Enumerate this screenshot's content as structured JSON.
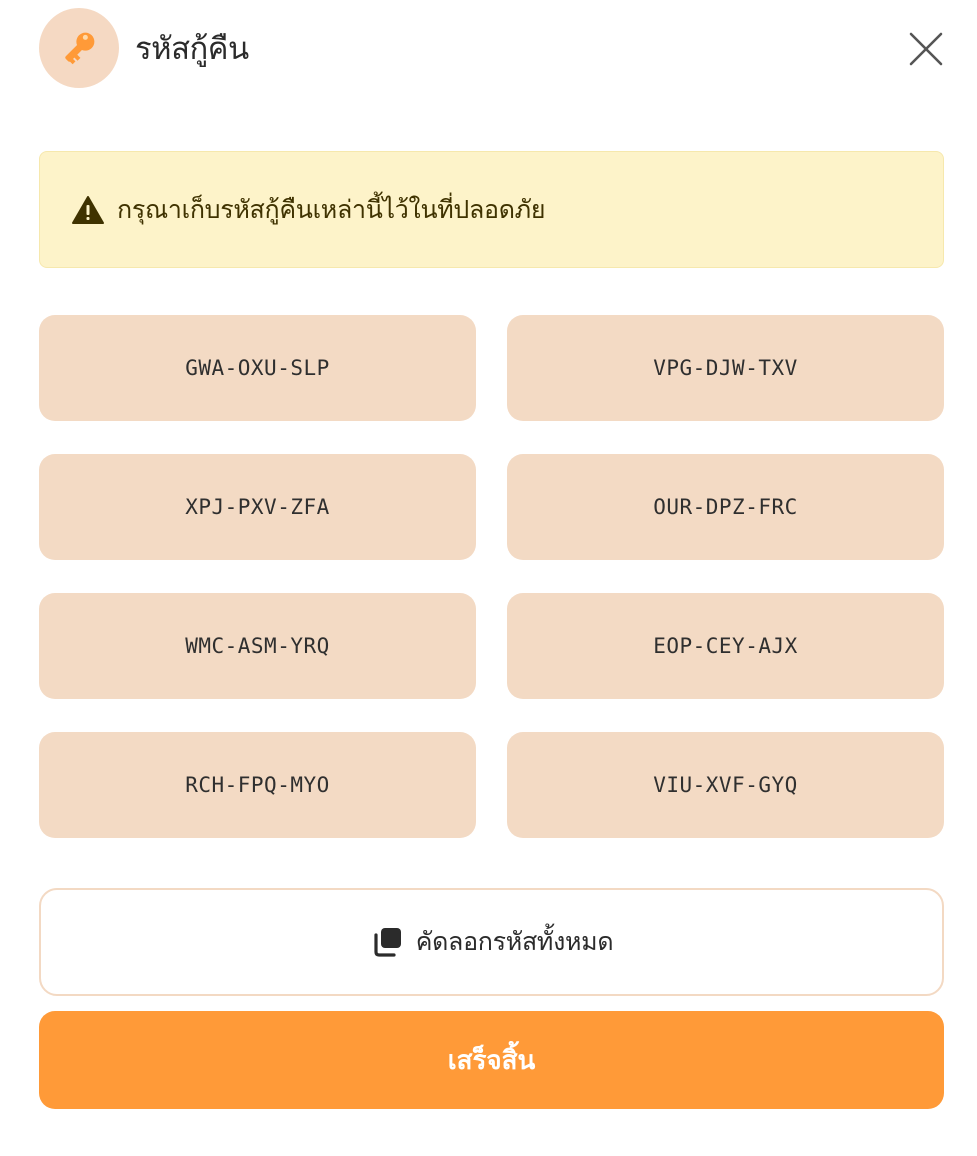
{
  "dialog": {
    "title": "รหัสกู้คืน",
    "title_icon": "key-icon",
    "close_icon": "close-icon"
  },
  "warning": {
    "icon": "warning-icon",
    "text": "กรุณาเก็บรหัสกู้คืนเหล่านี้ไว้ในที่ปลอดภัย"
  },
  "codes": [
    "GWA-OXU-SLP",
    "VPG-DJW-TXV",
    "XPJ-PXV-ZFA",
    "OUR-DPZ-FRC",
    "WMC-ASM-YRQ",
    "EOP-CEY-AJX",
    "RCH-FPQ-MYO",
    "VIU-XVF-GYQ"
  ],
  "actions": {
    "copy_icon": "copy-icon",
    "copy_label": "คัดลอกรหัสทั้งหมด",
    "done_label": "เสร็จสิ้น"
  },
  "colors": {
    "accent": "#ff9a38",
    "code_bg": "#f3dac4",
    "icon_bg": "#f5d9c3",
    "warning_bg": "#fdf3c9",
    "warning_text": "#3f3200"
  }
}
